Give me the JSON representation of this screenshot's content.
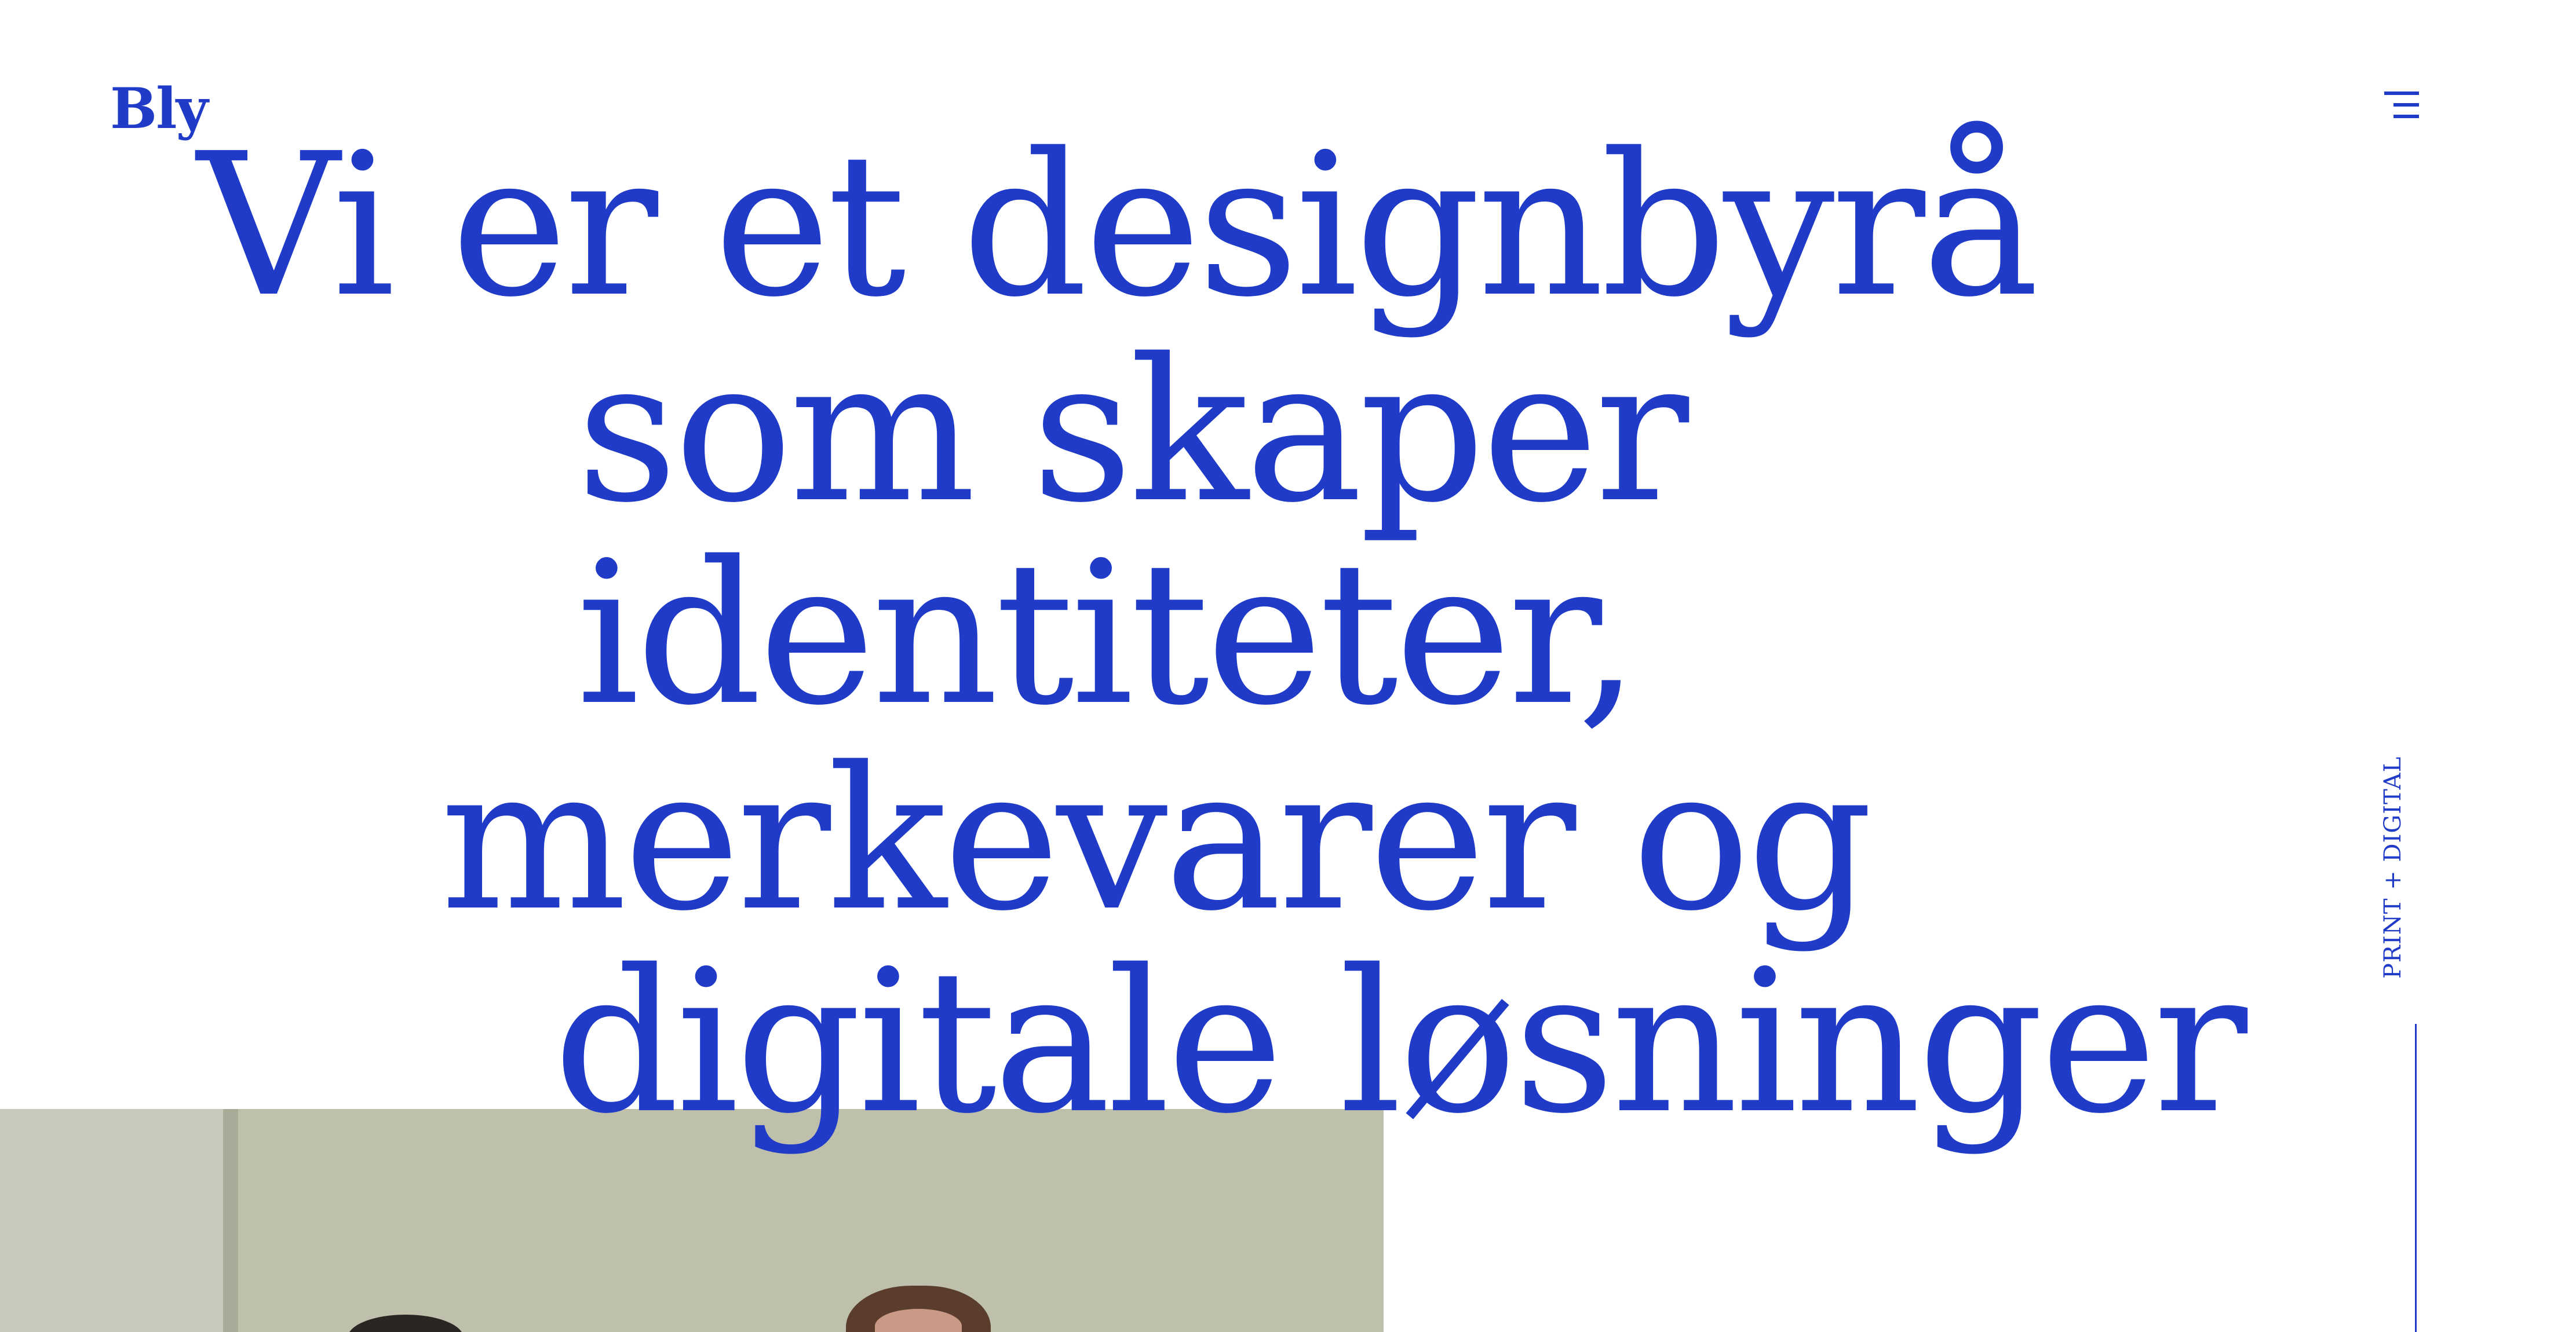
{
  "header": {
    "logo_text": "Bly",
    "menu_icon": "hamburger-menu-icon"
  },
  "hero": {
    "lines": [
      "Vi er et designbyrå",
      "som skaper",
      "identiteter,",
      "merkevarer og",
      "digitale løsninger"
    ]
  },
  "sidebar": {
    "label": "PRINT + DIGITAL"
  },
  "colors": {
    "brand": "#1f3bc8",
    "background": "#ffffff"
  }
}
